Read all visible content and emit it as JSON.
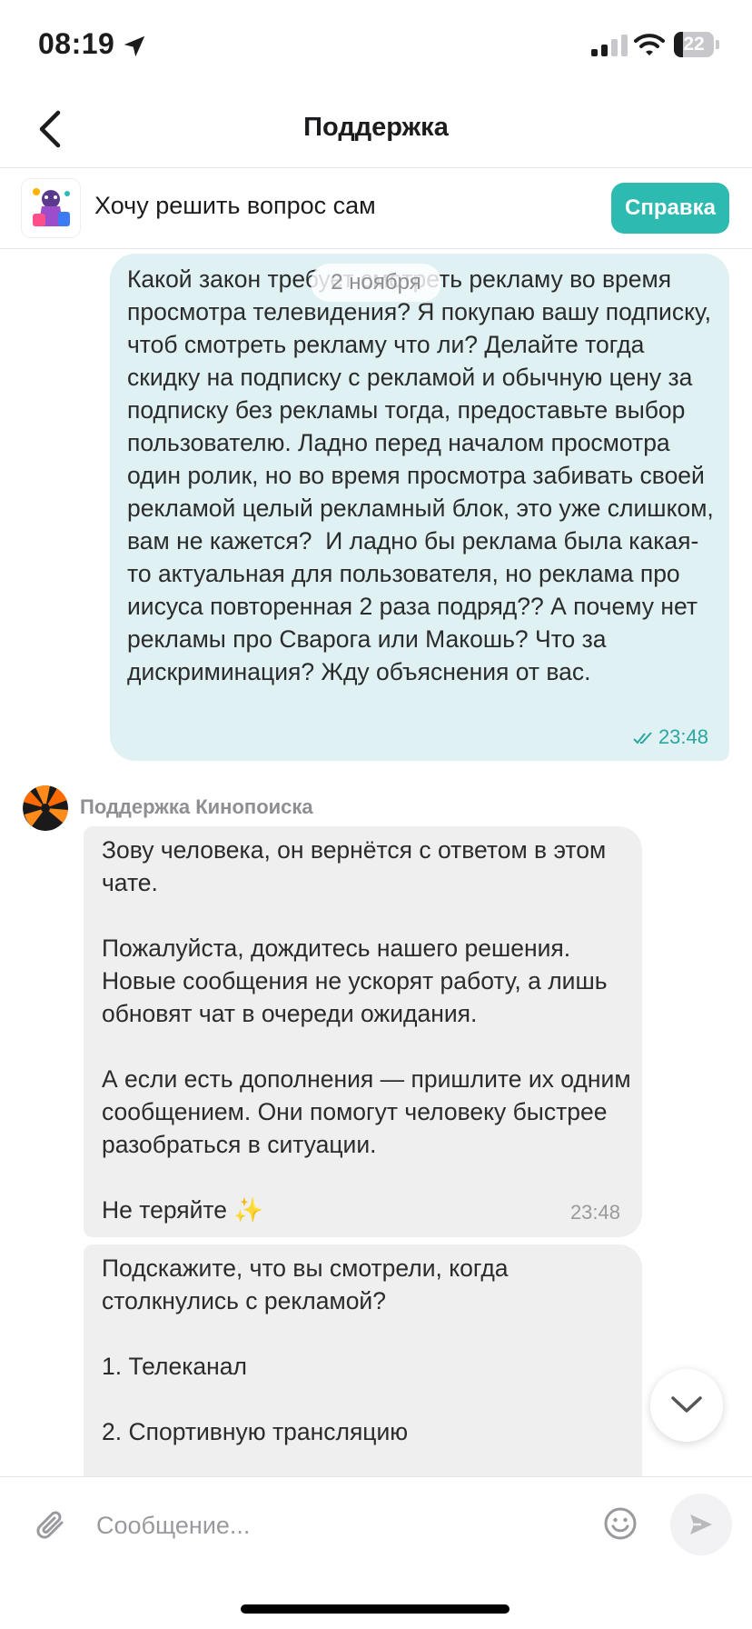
{
  "status_bar": {
    "time": "08:19",
    "battery": "22"
  },
  "header": {
    "title": "Поддержка"
  },
  "self_help": {
    "label": "Хочу решить вопрос сам",
    "button": "Справка"
  },
  "chat": {
    "date_chip": "2 ноября",
    "outgoing": {
      "text": "Какой закон требует смотреть рекламу во время просмотра телевидения? Я покупаю вашу подписку, чтоб смотреть рекламу что ли? Делайте тогда скидку на подписку с рекламой и обычную цену за подписку без рекламы тогда, предоставьте выбор пользователю. Ладно перед началом просмотра один ролик, но во время просмотра забивать своей рекламой целый рекламный блок, это уже слишком, вам не кажется?  И ладно бы реклама была какая-то актуальная для пользователя, но реклама про иисуса повторенная 2 раза подряд?? А почему нет рекламы про Сварога или Макошь? Что за дискриминация? Жду объяснения от вас.",
      "time": "23:48"
    },
    "agent_name": "Поддержка Кинопоиска",
    "incoming": [
      {
        "text": "Зову человека, он вернётся с ответом в этом чате.\n\nПожалуйста, дождитесь нашего решения. Новые сообщения не ускорят работу, а лишь обновят чат в очереди ожидания.\n\nА если есть дополнения — пришлите их одним сообщением. Они помогут человеку быстрее разобраться в ситуации.\n\nНе теряйте ✨",
        "time": "23:48"
      },
      {
        "text": "Подскажите, что вы смотрели, когда столкнулись с рекламой?\n\n1. Телеканал\n\n2. Спортивную трансляцию"
      }
    ]
  },
  "composer": {
    "placeholder": "Сообщение..."
  },
  "colors": {
    "accent": "#2cbab1",
    "outgoing_bubble": "#dff1f3",
    "incoming_bubble": "#efefef"
  },
  "icons": [
    "location-arrow-icon",
    "signal-icon",
    "wifi-icon",
    "battery-icon",
    "back-chevron-icon",
    "paperclip-icon",
    "emoji-icon",
    "send-icon",
    "chevron-down-icon",
    "double-check-icon"
  ]
}
